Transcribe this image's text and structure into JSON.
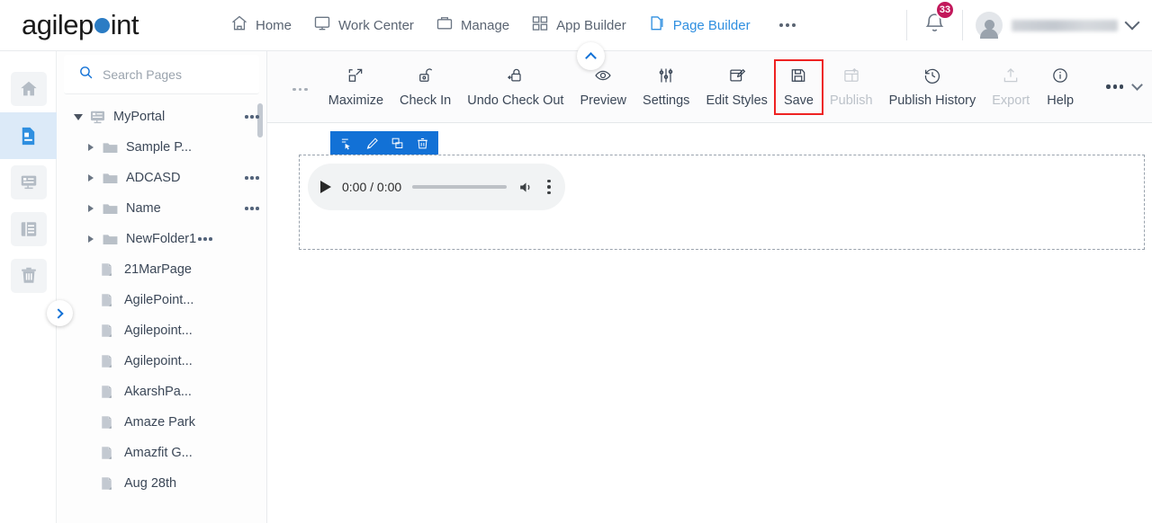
{
  "brand": {
    "name_part1": "agilep",
    "name_part2": "int"
  },
  "topnav": {
    "items": [
      {
        "label": "Home",
        "icon": "home-icon",
        "active": false
      },
      {
        "label": "Work Center",
        "icon": "monitor-icon",
        "active": false
      },
      {
        "label": "Manage",
        "icon": "briefcase-icon",
        "active": false
      },
      {
        "label": "App Builder",
        "icon": "grid-icon",
        "active": false
      },
      {
        "label": "Page Builder",
        "icon": "pages-icon",
        "active": true
      }
    ],
    "overflow": "more-options",
    "notification_count": "33",
    "username": ""
  },
  "rail": {
    "items": [
      {
        "name": "home",
        "icon": "home-icon",
        "active": false
      },
      {
        "name": "pages",
        "icon": "document-icon",
        "active": true
      },
      {
        "name": "forms",
        "icon": "form-list-icon",
        "active": false
      },
      {
        "name": "layouts",
        "icon": "layout-list-icon",
        "active": false
      },
      {
        "name": "recycle-bin",
        "icon": "trash-icon",
        "active": false
      }
    ]
  },
  "tree": {
    "search_placeholder": "Search Pages",
    "search_value": "",
    "nodes": [
      {
        "label": "MyPortal",
        "type": "portal",
        "indent": 0,
        "expander": "open",
        "menu": true
      },
      {
        "label": "Sample P...",
        "type": "folder",
        "indent": 1,
        "expander": "closed",
        "menu": false
      },
      {
        "label": "ADCASD",
        "type": "folder",
        "indent": 1,
        "expander": "closed",
        "menu": true
      },
      {
        "label": "Name",
        "type": "folder",
        "indent": 1,
        "expander": "closed",
        "menu": true
      },
      {
        "label": "NewFolder1",
        "type": "folder",
        "indent": 1,
        "expander": "closed",
        "menu": true
      },
      {
        "label": "21MarPage",
        "type": "page",
        "indent": 2,
        "expander": "none",
        "menu": false
      },
      {
        "label": "AgilePoint...",
        "type": "page",
        "indent": 2,
        "expander": "none",
        "menu": false
      },
      {
        "label": "Agilepoint...",
        "type": "page",
        "indent": 2,
        "expander": "none",
        "menu": false
      },
      {
        "label": "Agilepoint...",
        "type": "page",
        "indent": 2,
        "expander": "none",
        "menu": false
      },
      {
        "label": "AkarshPa...",
        "type": "page",
        "indent": 2,
        "expander": "none",
        "menu": false
      },
      {
        "label": "Amaze Park",
        "type": "page",
        "indent": 2,
        "expander": "none",
        "menu": false
      },
      {
        "label": "Amazfit G...",
        "type": "page",
        "indent": 2,
        "expander": "none",
        "menu": false
      },
      {
        "label": "Aug 28th",
        "type": "page",
        "indent": 2,
        "expander": "none",
        "menu": false
      }
    ]
  },
  "toolbar": {
    "items": [
      {
        "label": "Maximize",
        "icon": "maximize-icon",
        "disabled": false,
        "highlighted": false
      },
      {
        "label": "Check In",
        "icon": "unlock-icon",
        "disabled": false,
        "highlighted": false
      },
      {
        "label": "Undo Check Out",
        "icon": "lock-undo-icon",
        "disabled": false,
        "highlighted": false
      },
      {
        "label": "Preview",
        "icon": "eye-icon",
        "disabled": false,
        "highlighted": false
      },
      {
        "label": "Settings",
        "icon": "sliders-icon",
        "disabled": false,
        "highlighted": false
      },
      {
        "label": "Edit Styles",
        "icon": "edit-styles-icon",
        "disabled": false,
        "highlighted": false
      },
      {
        "label": "Save",
        "icon": "save-icon",
        "disabled": false,
        "highlighted": true
      },
      {
        "label": "Publish",
        "icon": "publish-icon",
        "disabled": true,
        "highlighted": false
      },
      {
        "label": "Publish History",
        "icon": "history-icon",
        "disabled": false,
        "highlighted": false
      },
      {
        "label": "Export",
        "icon": "export-icon",
        "disabled": true,
        "highlighted": false
      },
      {
        "label": "Help",
        "icon": "info-icon",
        "disabled": false,
        "highlighted": false
      }
    ],
    "highlight_color": "#ee2222",
    "collapse_icon": "chevron-up-icon",
    "leading_dots": "more-options"
  },
  "canvas": {
    "widget_toolbar": [
      {
        "name": "select-parent-icon"
      },
      {
        "name": "edit-icon"
      },
      {
        "name": "duplicate-icon"
      },
      {
        "name": "delete-icon"
      }
    ],
    "audio": {
      "time": "0:00 / 0:00",
      "play_icon": "play-icon",
      "volume_icon": "volume-icon",
      "menu_icon": "kebab-menu-icon"
    }
  }
}
